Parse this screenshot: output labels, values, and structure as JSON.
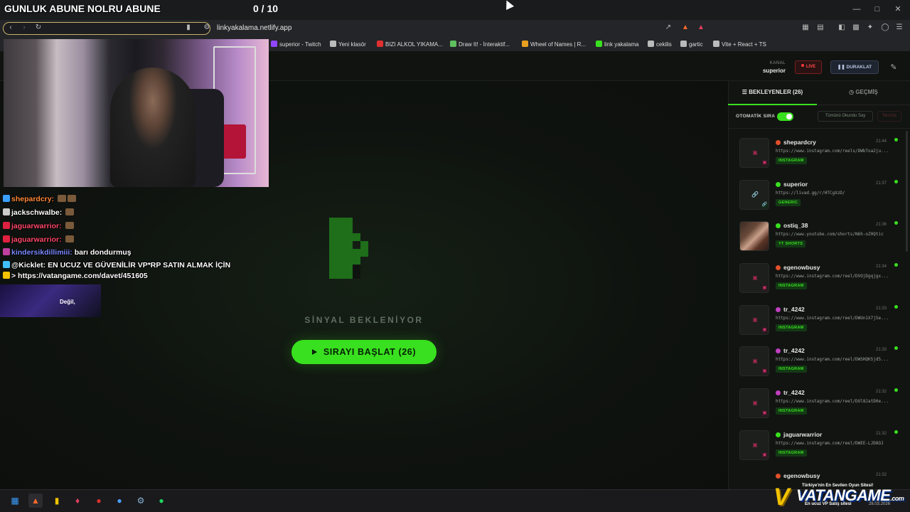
{
  "overlay": {
    "goal_text": "GUNLUK ABUNE NOLRU ABUNE",
    "goal_count": "0 / 10"
  },
  "browser": {
    "url": "linkyakalama.netlify.app",
    "bookmarks": [
      {
        "label": "superior - Twitch",
        "color": "#9146ff"
      },
      {
        "label": "Yeni klasör",
        "color": "#bbbbbb"
      },
      {
        "label": "BIZI ALKOL YIKAMA...",
        "color": "#e03030"
      },
      {
        "label": "Draw It! - İnteraktif...",
        "color": "#5fbf5f"
      },
      {
        "label": "Wheel of Names | R...",
        "color": "#e8a020"
      },
      {
        "label": "link yakalama",
        "color": "#39e01f"
      },
      {
        "label": "cekilis",
        "color": "#bbbbbb"
      },
      {
        "label": "gartic",
        "color": "#bbbbbb"
      },
      {
        "label": "Vite + React + TS",
        "color": "#bbbbbb"
      }
    ]
  },
  "header": {
    "channel_label": "KANAL",
    "channel_name": "superior",
    "live_label": "LIVE",
    "pause_label": "DURAKLAT"
  },
  "stage": {
    "signal_text": "SİNYAL BEKLENİYOR",
    "start_button": "SIRAYI BAŞLAT (26)"
  },
  "sidebar": {
    "tab_queue": "BEKLEYENLER (26)",
    "tab_history": "GEÇMİŞ",
    "auto_label": "OTOMATİK SIRA",
    "auto_on": true,
    "mark_all": "Tümünü Okundu Say",
    "clear": "Temizle",
    "items": [
      {
        "user": "shepardcry",
        "time": "21:44",
        "url": "https://www.instagram.com/reels/DWbToa2ju...",
        "tag": "INSTAGRAM",
        "badge": "#e0502a",
        "thumb": "instagram"
      },
      {
        "user": "superior",
        "time": "21:37",
        "url": "https://livad.gg/r/HTCgXzD/",
        "tag": "GENERIC",
        "badge": "#39e01f",
        "thumb": "generic"
      },
      {
        "user": "ostiq_38",
        "time": "21:36",
        "url": "https://www.youtube.com/shorts/N6h-oZ0Qtic",
        "tag": "YT SHORTS",
        "badge": "#39e01f",
        "thumb": "photo"
      },
      {
        "user": "egenowbusy",
        "time": "21:34",
        "url": "https://www.instagram.com/reel/DVOjDgqjgx...",
        "tag": "INSTAGRAM",
        "badge": "#e0502a",
        "thumb": "instagram"
      },
      {
        "user": "tr_4242",
        "time": "21:33",
        "url": "https://www.instagram.com/reel/DWUn1X7j5e...",
        "tag": "INSTAGRAM",
        "badge": "#c040c0",
        "thumb": "instagram"
      },
      {
        "user": "tr_4242",
        "time": "21:33",
        "url": "https://www.instagram.com/reel/DWSHQKSjd5...",
        "tag": "INSTAGRAM",
        "badge": "#c040c0",
        "thumb": "instagram"
      },
      {
        "user": "tr_4242",
        "time": "21:32",
        "url": "https://www.instagram.com/reel/DUl8JatD0e...",
        "tag": "INSTAGRAM",
        "badge": "#c040c0",
        "thumb": "instagram"
      },
      {
        "user": "jaguarwarrior",
        "time": "21:32",
        "url": "https://www.instagram.com/reel/DWEE-LJD8OJ",
        "tag": "INSTAGRAM",
        "badge": "#39e01f",
        "thumb": "instagram"
      },
      {
        "user": "egenowbusy",
        "time": "21:32",
        "url": "",
        "tag": "",
        "badge": "#e0502a",
        "thumb": "none"
      }
    ]
  },
  "chat": [
    {
      "user": "shepardcry:",
      "msg": "",
      "color": "#ff8a3a",
      "emotes": 2
    },
    {
      "user": "jackschwalbe:",
      "msg": "",
      "color": "#ffffff",
      "emotes": 1
    },
    {
      "user": "jaguarwarrior:",
      "msg": "",
      "color": "#ff4a6a",
      "emotes": 1
    },
    {
      "user": "jaguarwarrior:",
      "msg": "",
      "color": "#ff4a6a",
      "emotes": 1
    },
    {
      "user": "kindersikdillimiii:",
      "msg": "barı dondurmuş",
      "color": "#7a8aff",
      "emotes": 0
    },
    {
      "user": "@Kicklet:",
      "msg": "EN UCUZ VE GÜVENİLİR VP*RP SATIN ALMAK İÇİN",
      "color": "#ffffff",
      "emotes": 0
    },
    {
      "user": "",
      "msg": "> https://vatangame.com/davet/451605",
      "color": "#ffffff",
      "emotes": 0
    }
  ],
  "chat_banner_text": "Değil,",
  "sponsor": {
    "slogan1": "Türkiye'nin En Sevilen Oyun Sitesi!",
    "name": "VATANGAME",
    "suffix": ".com",
    "slogan2": "En ucuz VP Satış sitesi",
    "date": "28.03.2026"
  }
}
